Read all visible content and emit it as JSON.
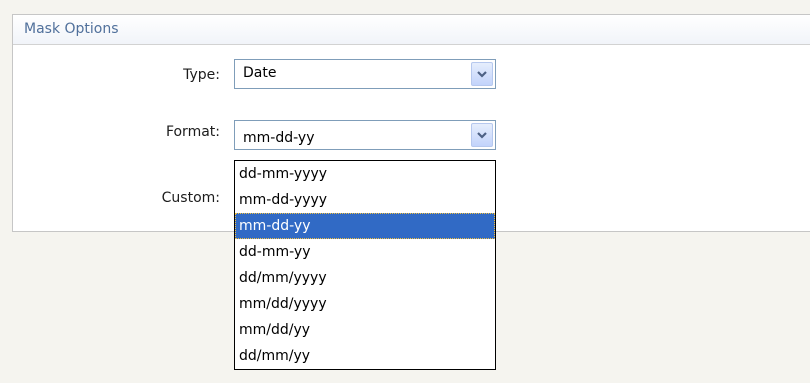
{
  "panel": {
    "title": "Mask Options"
  },
  "type_field": {
    "label": "Type:",
    "value": "Date"
  },
  "format_field": {
    "label": "Format:",
    "value": "mm-dd-yy",
    "options": [
      "dd-mm-yyyy",
      "mm-dd-yyyy",
      "mm-dd-yy",
      "dd-mm-yy",
      "dd/mm/yyyy",
      "mm/dd/yyyy",
      "mm/dd/yy",
      "dd/mm/yy"
    ],
    "selected_index": 2
  },
  "custom_field": {
    "label": "Custom:",
    "value": ""
  },
  "icons": {
    "dropdown_arrow": "chevron-down-icon"
  },
  "colors": {
    "selection": "#316ac5",
    "header_text": "#50709b",
    "border": "#7f9db9"
  }
}
